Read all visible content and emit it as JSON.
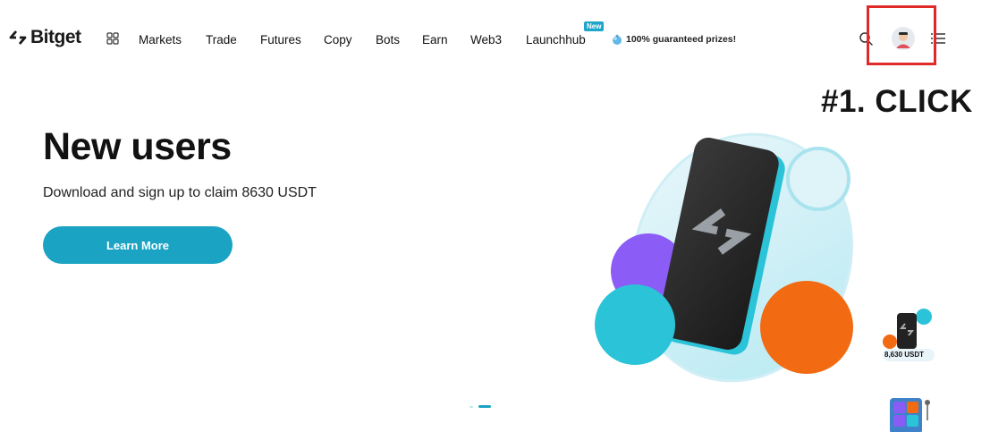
{
  "brand": {
    "name": "Bitget"
  },
  "nav": {
    "items": [
      {
        "key": "markets",
        "label": "Markets"
      },
      {
        "key": "trade",
        "label": "Trade"
      },
      {
        "key": "futures",
        "label": "Futures"
      },
      {
        "key": "copy",
        "label": "Copy"
      },
      {
        "key": "bots",
        "label": "Bots"
      },
      {
        "key": "earn",
        "label": "Earn"
      },
      {
        "key": "web3",
        "label": "Web3"
      },
      {
        "key": "launchhub",
        "label": "Launchhub"
      }
    ],
    "new_badge": "New",
    "promo": "100% guaranteed prizes!"
  },
  "icons": {
    "apps": "apps-grid-icon",
    "search": "search-icon",
    "profile": "user-avatar",
    "menu": "menu-icon"
  },
  "annotation": {
    "text": "#1. CLICK",
    "color": "#e02a2a"
  },
  "hero": {
    "title": "New users",
    "subtitle": "Download and sign up to claim 8630 USDT",
    "cta": "Learn More"
  },
  "side_widget": {
    "amount": "8,630 USDT"
  },
  "colors": {
    "accent": "#1aa3c3",
    "highlight": "#e02a2a",
    "orange": "#f26a12",
    "purple": "#8b5cf6"
  }
}
